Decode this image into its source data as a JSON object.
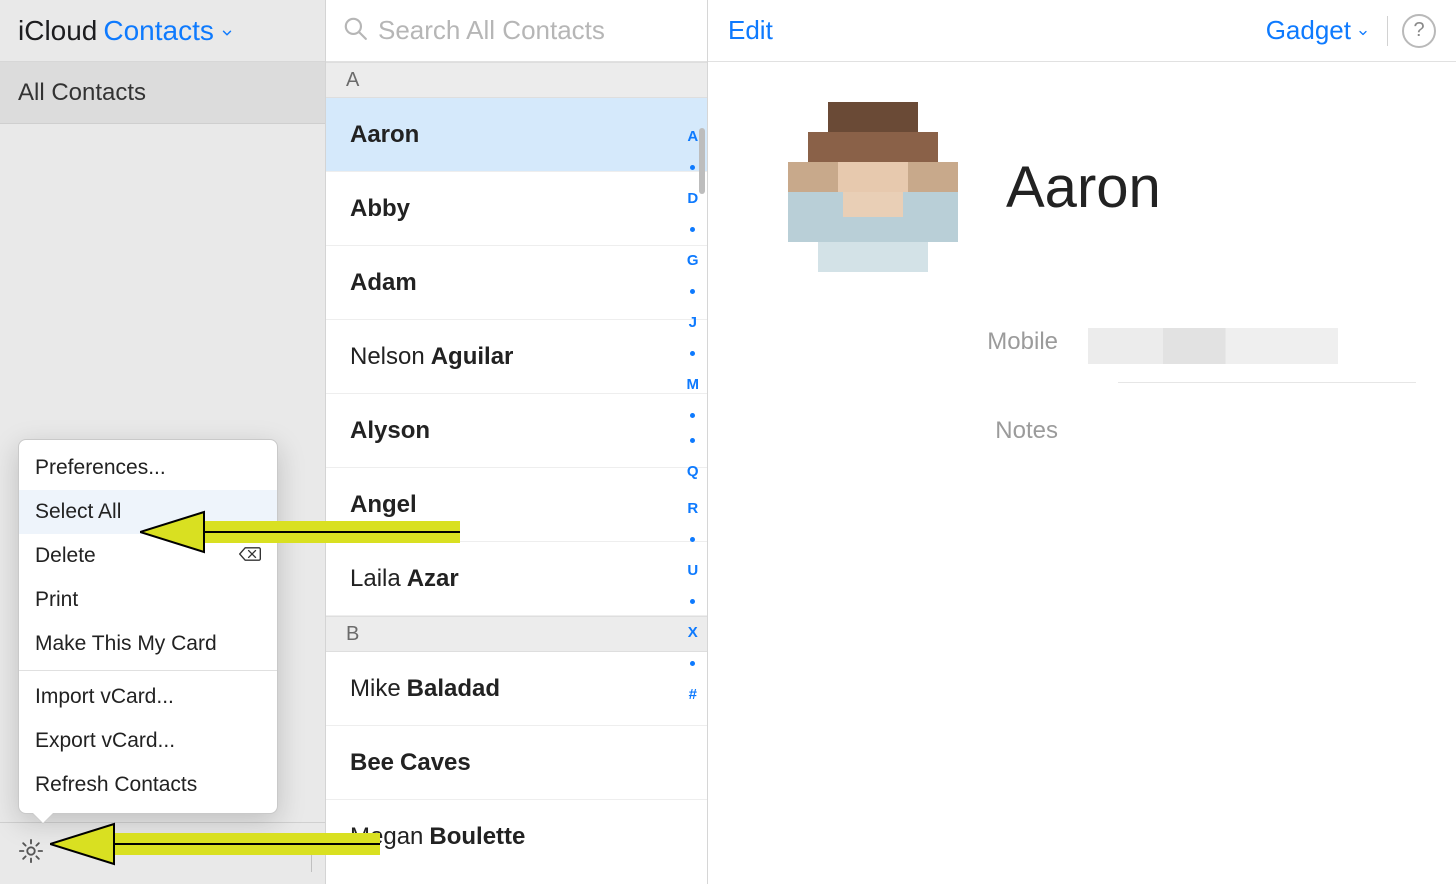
{
  "header": {
    "brand": "iCloud",
    "section": "Contacts"
  },
  "sidebar": {
    "group_label": "All Contacts"
  },
  "popup": {
    "items": [
      {
        "label": "Preferences...",
        "selected": false
      },
      {
        "label": "Select All",
        "selected": true
      },
      {
        "label": "Delete",
        "selected": false,
        "trailing_icon": "delete-icon"
      },
      {
        "label": "Print",
        "selected": false
      },
      {
        "label": "Make This My Card",
        "selected": false
      }
    ],
    "items2": [
      {
        "label": "Import vCard..."
      },
      {
        "label": "Export vCard..."
      },
      {
        "label": "Refresh Contacts"
      }
    ]
  },
  "search": {
    "placeholder": "Search All Contacts"
  },
  "sections": [
    {
      "letter": "A",
      "rows": [
        {
          "first": "Aaron",
          "last": "",
          "mono": true,
          "selected": true
        },
        {
          "first": "Abby",
          "last": "",
          "mono": true
        },
        {
          "first": "Adam",
          "last": "",
          "mono": true
        },
        {
          "first": "Nelson",
          "last": "Aguilar"
        },
        {
          "first": "Alyson",
          "last": "",
          "mono": true
        },
        {
          "first": "Angel",
          "last": "",
          "mono": true
        },
        {
          "first": "Laila",
          "last": "Azar"
        }
      ]
    },
    {
      "letter": "B",
      "rows": [
        {
          "first": "Mike",
          "last": "Baladad"
        },
        {
          "first": "Bee",
          "last": "Caves",
          "bold_all": true
        },
        {
          "first": "Megan",
          "last": "Boulette"
        }
      ]
    }
  ],
  "alpha_index": [
    "A",
    "•",
    "D",
    "•",
    "G",
    "•",
    "J",
    "•",
    "M",
    "•",
    "•",
    "Q",
    "R",
    "•",
    "U",
    "•",
    "X",
    "•",
    "#"
  ],
  "detail": {
    "edit": "Edit",
    "gadget": "Gadget",
    "name": "Aaron",
    "fields": {
      "mobile_label": "Mobile",
      "notes_label": "Notes"
    }
  }
}
